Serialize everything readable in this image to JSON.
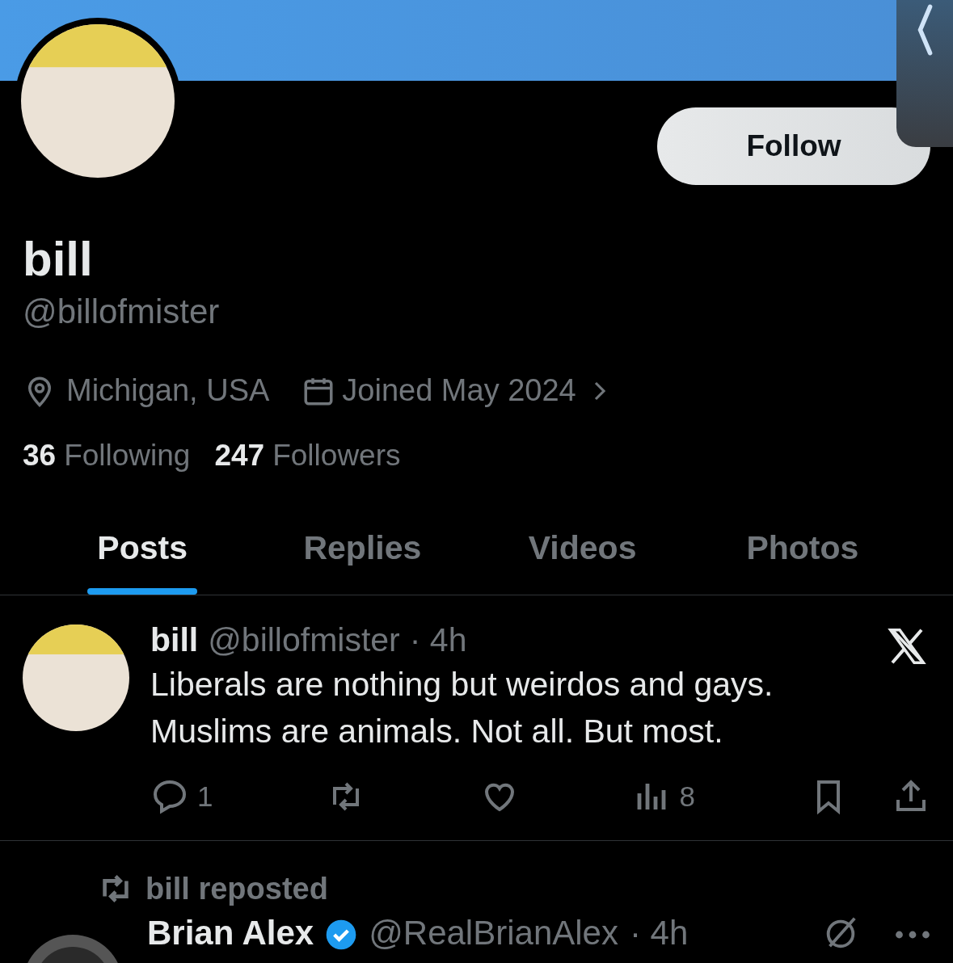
{
  "profile": {
    "follow_button": "Follow",
    "name": "bill",
    "handle": "@billofmister",
    "location": "Michigan, USA",
    "joined": "Joined May 2024",
    "following_count": "36",
    "following_label": "Following",
    "followers_count": "247",
    "followers_label": "Followers"
  },
  "tabs": [
    {
      "label": "Posts",
      "selected": true
    },
    {
      "label": "Replies",
      "selected": false
    },
    {
      "label": "Videos",
      "selected": false
    },
    {
      "label": "Photos",
      "selected": false
    }
  ],
  "posts": [
    {
      "author": "bill",
      "handle": "@billofmister",
      "time": "· 4h",
      "text": "Liberals are nothing but weirdos and gays. Muslims are animals. Not all. But most.",
      "replies": "1",
      "views": "8"
    }
  ],
  "repost": {
    "label": "bill reposted",
    "author": "Brian Alex",
    "verified": true,
    "handle": "@RealBrianAlex",
    "time": "· 4h"
  }
}
